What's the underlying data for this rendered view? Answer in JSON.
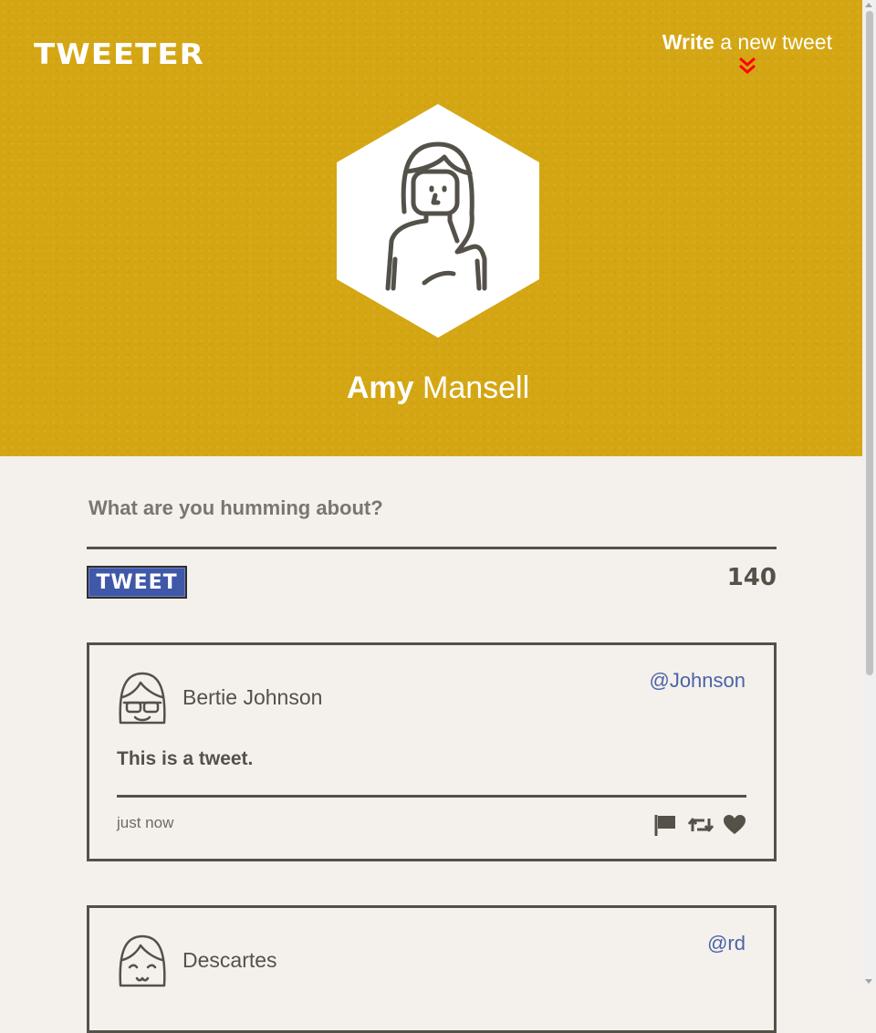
{
  "app": {
    "logo": "TWEETER"
  },
  "compose_toggle": {
    "bold": "Write",
    "rest": " a new tweet",
    "icon": "double-chevron-down-icon",
    "icon_color": "#ff0000"
  },
  "profile": {
    "first_name": "Amy",
    "last_name": " Mansell",
    "avatar": "woman-avatar-icon"
  },
  "new_tweet": {
    "placeholder": "What are you humming about?",
    "button_label": "TWEET",
    "counter": "140"
  },
  "tweets": [
    {
      "author": "Bertie Johnson",
      "handle": "@Johnson",
      "text": "This is a tweet.",
      "time": "just now",
      "avatar": "sunglasses-avatar-icon",
      "actions": [
        "flag-icon",
        "retweet-icon",
        "heart-icon"
      ]
    },
    {
      "author": "Descartes",
      "handle": "@rd",
      "avatar": "smiling-avatar-icon"
    }
  ],
  "colors": {
    "header_bg": "#d4a613",
    "page_bg": "#f4f1ec",
    "ink": "#545149",
    "accent": "#4058a8"
  }
}
